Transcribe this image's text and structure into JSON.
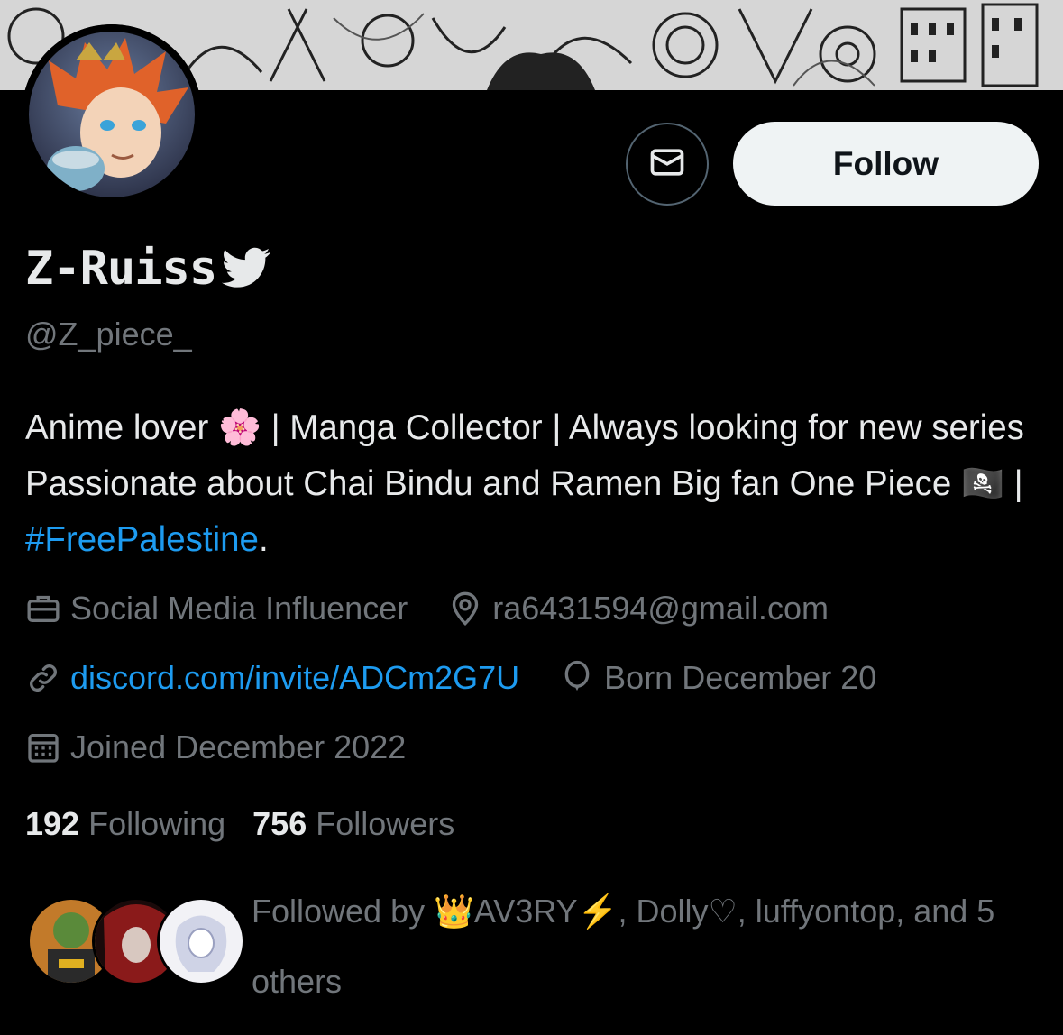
{
  "profile": {
    "display_name": "Z-Ruiss",
    "handle": "@Z_piece_",
    "bio_text": "Anime lover 🌸 | Manga Collector | Always looking for new series Passionate about Chai Bindu and Ramen Big fan One Piece 🏴‍☠️ | ",
    "bio_hashtag": "#FreePalestine",
    "bio_end": ".",
    "category": "Social Media Influencer",
    "location": "ra6431594@gmail.com",
    "website": "discord.com/invite/ADCm2G7U",
    "birthday": "Born December 20",
    "joined": "Joined December 2022"
  },
  "actions": {
    "follow_label": "Follow",
    "message_icon": "envelope-icon"
  },
  "stats": {
    "following_count": "192",
    "following_label": "Following",
    "followers_count": "756",
    "followers_label": "Followers"
  },
  "followed_by": {
    "text": "Followed by 👑AV3RY⚡️, Dolly♡, luffyontop, and 5 others"
  },
  "colors": {
    "background": "#000000",
    "link": "#1d9bf0",
    "muted": "#71767b",
    "primary_text": "#e7e9ea"
  }
}
